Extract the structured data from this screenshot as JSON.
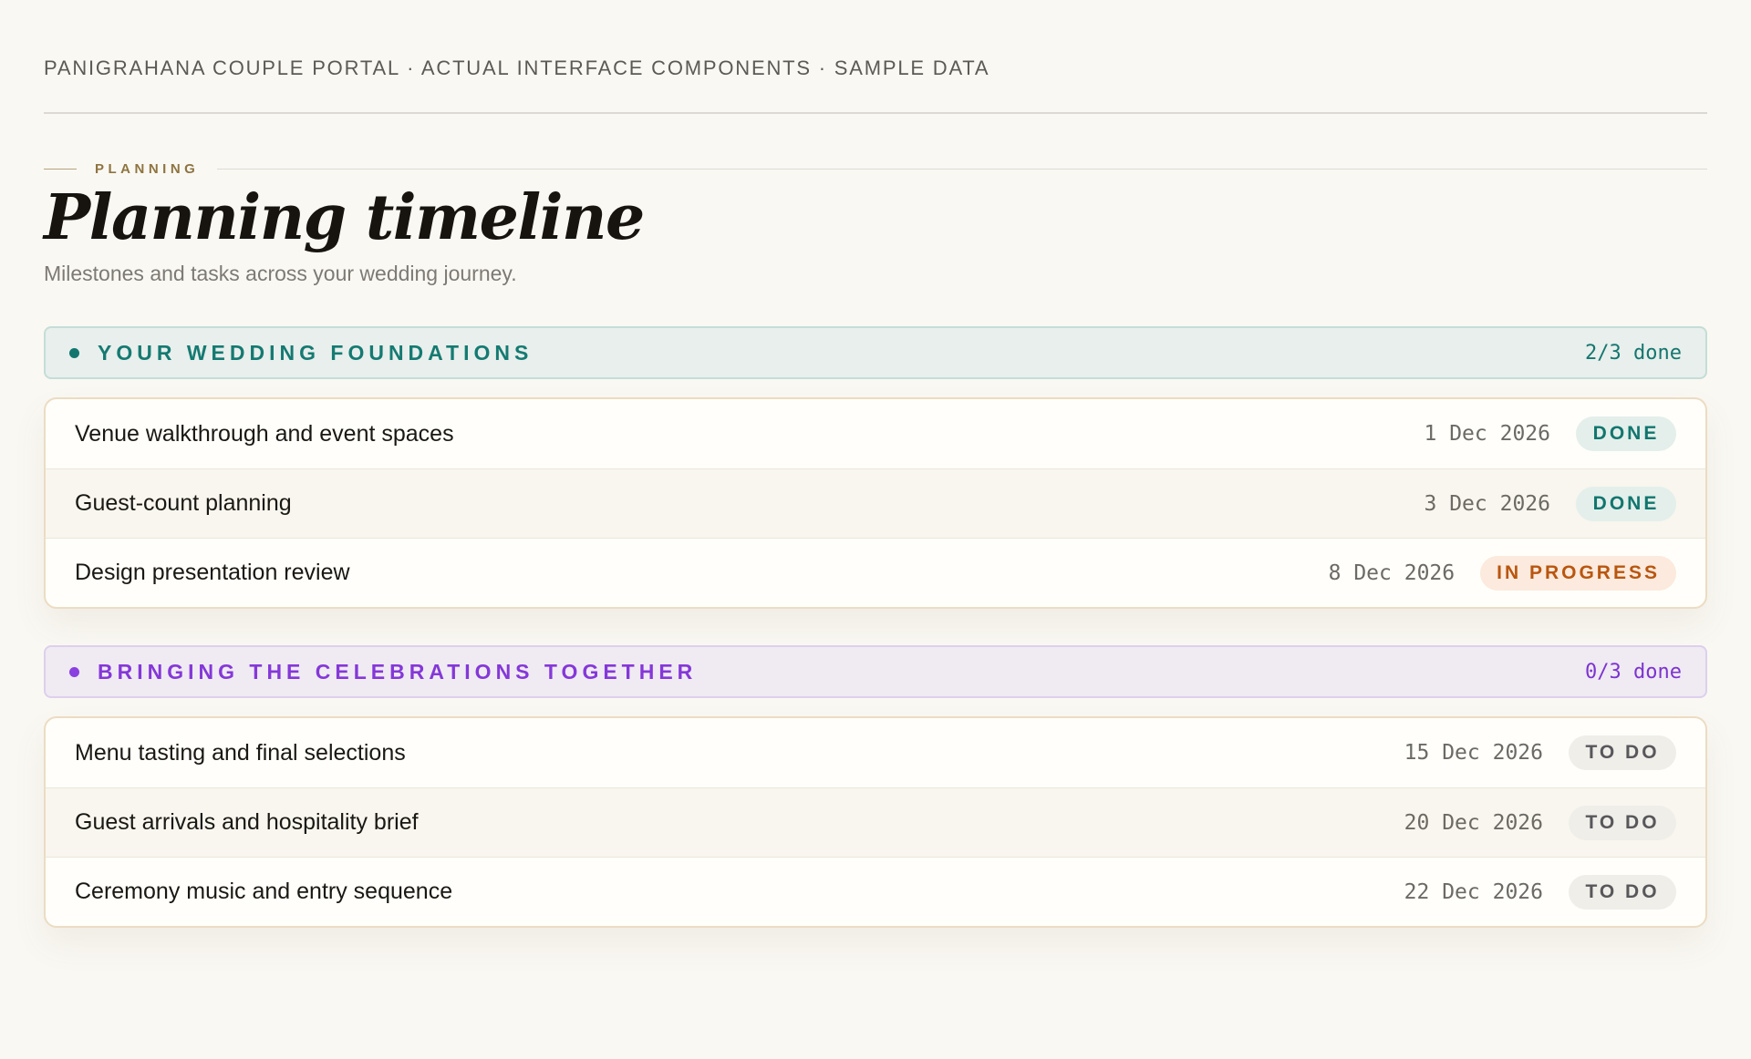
{
  "caption": "PANIGRAHANA COUPLE PORTAL · ACTUAL INTERFACE COMPONENTS · SAMPLE DATA",
  "section": {
    "eyebrow": "PLANNING",
    "title": "Planning timeline",
    "subtitle": "Milestones and tasks across your wedding journey."
  },
  "groups": [
    {
      "title": "YOUR WEDDING FOUNDATIONS",
      "count": "2/3 done",
      "accent": "#157a72",
      "tasks": [
        {
          "name": "Venue walkthrough and event spaces",
          "date": "1 Dec 2026",
          "status": "DONE"
        },
        {
          "name": "Guest-count planning",
          "date": "3 Dec 2026",
          "status": "DONE"
        },
        {
          "name": "Design presentation review",
          "date": "8 Dec 2026",
          "status": "IN PROGRESS"
        }
      ]
    },
    {
      "title": "BRINGING THE CELEBRATIONS TOGETHER",
      "count": "0/3 done",
      "accent": "#8438d8",
      "tasks": [
        {
          "name": "Menu tasting and final selections",
          "date": "15 Dec 2026",
          "status": "TO DO"
        },
        {
          "name": "Guest arrivals and hospitality brief",
          "date": "20 Dec 2026",
          "status": "TO DO"
        },
        {
          "name": "Ceremony music and entry sequence",
          "date": "22 Dec 2026",
          "status": "TO DO"
        }
      ]
    }
  ],
  "status_colors": {
    "done": "#11766e",
    "in_progress": "#b9560f",
    "to_do": "#58575a"
  }
}
